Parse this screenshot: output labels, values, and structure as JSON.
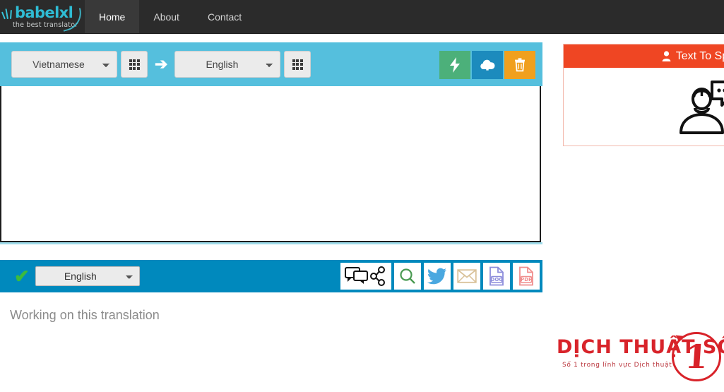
{
  "navbar": {
    "brand": {
      "name": "babelxl",
      "tagline": "the best translator"
    },
    "links": [
      {
        "label": "Home",
        "active": true
      },
      {
        "label": "About",
        "active": false
      },
      {
        "label": "Contact",
        "active": false
      }
    ]
  },
  "translator": {
    "source_language": "Vietnamese",
    "target_language": "English",
    "source_text": "",
    "source_placeholder": "",
    "arrow": "➔",
    "buttons": {
      "translate": "translate-button",
      "upload": "upload-button",
      "clear": "clear-button"
    }
  },
  "result": {
    "language": "English",
    "status_text": "Working on this translation",
    "tools": [
      {
        "name": "chat-share-icon",
        "label": "Share"
      },
      {
        "name": "search-icon",
        "label": "Search"
      },
      {
        "name": "twitter-icon",
        "label": "Twitter"
      },
      {
        "name": "email-icon",
        "label": "Email"
      },
      {
        "name": "doc-icon",
        "label": "DOC"
      },
      {
        "name": "pdf-icon",
        "label": "PDF"
      }
    ]
  },
  "tts_panel": {
    "title": "Text To Spe"
  },
  "partner_logo": {
    "title": "DỊCH THUẬT SỐ",
    "number": "1",
    "tagline": "Số 1 trong lĩnh vực Dịch thuật"
  },
  "colors": {
    "navbar_bg": "#2b2b2b",
    "brand_accent": "#2fbcd4",
    "toolbar_blue": "#55bfdd",
    "result_blue": "#0089bd",
    "translate_green": "#4cb07a",
    "upload_blue": "#1c8bbd",
    "clear_orange": "#f0a01e",
    "tts_red": "#ef4623",
    "logo_red": "#d8232a"
  }
}
